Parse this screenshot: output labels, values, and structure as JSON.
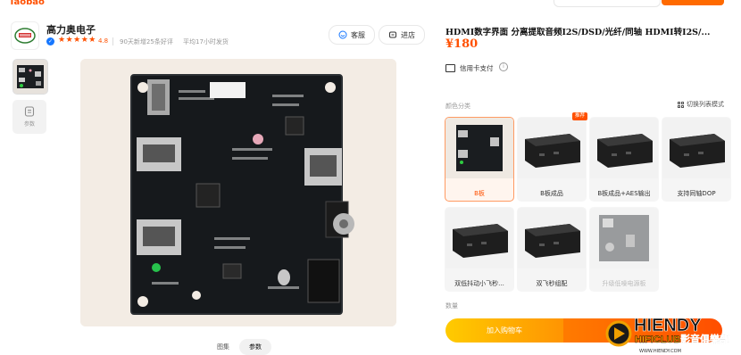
{
  "brand": "Taobao",
  "shop": {
    "name": "高力奥电子",
    "arrow": "›",
    "rating": "4.8",
    "stars": "★★★★★",
    "stat_reviews": "90天新增25条好评",
    "stat_shipping": "平均17小时发货",
    "service_label": "客服",
    "enter_label": "进店"
  },
  "gallery": {
    "video_label": "参数",
    "tabs": [
      "图集",
      "参数"
    ]
  },
  "product": {
    "title": "HDMI数字界面 分离提取音频I2S/DSD/光纤/同轴 HDMI转I2S/...",
    "price": "¥180",
    "payment": "信用卡支付"
  },
  "variants": {
    "section_label": "颜色分类",
    "switch_label": "切换列表模式",
    "hot_badge": "推荐",
    "options": [
      {
        "label": "B板",
        "selected": true,
        "disabled": false
      },
      {
        "label": "B板成品",
        "selected": false,
        "disabled": false
      },
      {
        "label": "B板成品+AES输出",
        "selected": false,
        "disabled": false
      },
      {
        "label": "支持同轴DOP",
        "selected": false,
        "disabled": false
      },
      {
        "label": "双低抖动小飞秒...",
        "selected": false,
        "disabled": false
      },
      {
        "label": "双飞秒组配",
        "selected": false,
        "disabled": false
      },
      {
        "label": "升级低噪电源板",
        "selected": false,
        "disabled": true
      }
    ]
  },
  "quantity_label": "数量",
  "actions": {
    "add_to_cart": "加入购物车"
  },
  "watermark": {
    "main": "HIENDY",
    "sub": "HIFICLUB",
    "cn": "影音俱樂部",
    "url": "WWW.HIENDY.COM"
  },
  "colors": {
    "accent": "#ff5000",
    "cart_start": "#ffcb00",
    "cart_end": "#ff9402",
    "buy_start": "#ff7b00",
    "buy_end": "#ff4e00"
  }
}
